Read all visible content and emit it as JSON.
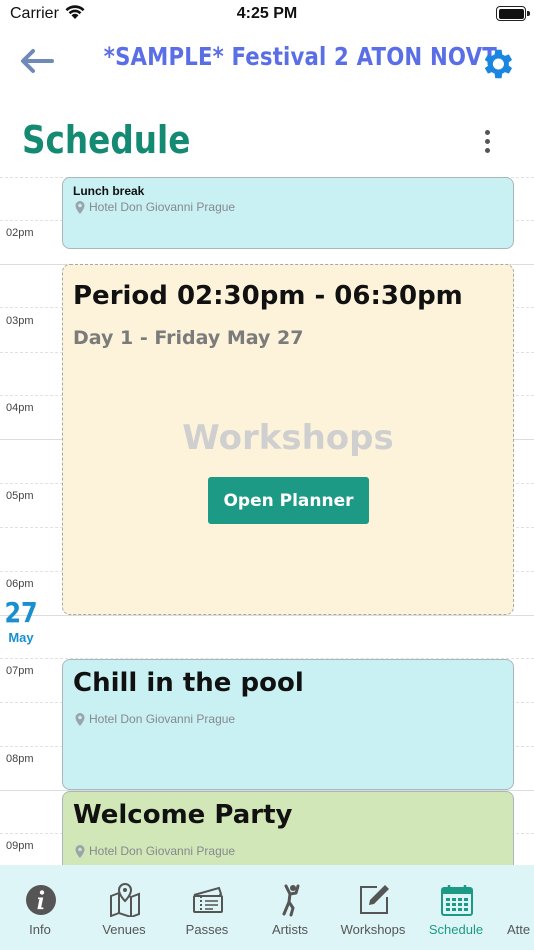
{
  "status": {
    "carrier": "Carrier",
    "time": "4:25 PM"
  },
  "nav": {
    "title": "*SAMPLE* Festival 2 ATON NOVT"
  },
  "page": {
    "title": "Schedule"
  },
  "timeline": {
    "hours": [
      "02pm",
      "03pm",
      "04pm",
      "05pm",
      "06pm",
      "07pm",
      "08pm",
      "09pm"
    ],
    "date": {
      "day": "27",
      "month": "May"
    }
  },
  "events": {
    "lunch": {
      "title": "Lunch break",
      "location": "Hotel Don Giovanni Prague"
    },
    "period": {
      "title": "Period 02:30pm - 06:30pm",
      "subtitle": "Day 1 - Friday May 27",
      "type": "Workshops",
      "button": "Open Planner"
    },
    "pool": {
      "title": "Chill in the pool",
      "location": "Hotel Don Giovanni Prague"
    },
    "party": {
      "title": "Welcome Party",
      "location": "Hotel Don Giovanni Prague"
    }
  },
  "tabs": [
    {
      "label": "Info",
      "icon": "info-icon"
    },
    {
      "label": "Venues",
      "icon": "map-icon"
    },
    {
      "label": "Passes",
      "icon": "ticket-icon"
    },
    {
      "label": "Artists",
      "icon": "dancer-icon"
    },
    {
      "label": "Workshops",
      "icon": "edit-icon"
    },
    {
      "label": "Schedule",
      "icon": "calendar-icon",
      "active": true
    },
    {
      "label": "Atte",
      "icon": "people-icon"
    }
  ],
  "colors": {
    "accent": "#1d9a85",
    "title": "#5a6ee6",
    "gear": "#1a86e0",
    "date": "#1a8fd0",
    "tabbar": "#ddf5f6"
  }
}
